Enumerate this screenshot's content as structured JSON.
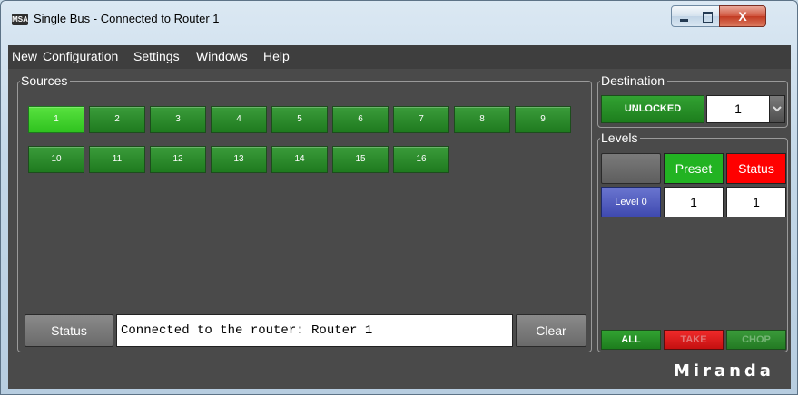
{
  "window": {
    "title": "Single Bus - Connected to Router 1",
    "icon_text": "MSA",
    "close_glyph": "X"
  },
  "menu": [
    "New",
    "Configuration",
    "Settings",
    "Windows",
    "Help"
  ],
  "sources": {
    "title": "Sources",
    "buttons": [
      "1",
      "2",
      "3",
      "4",
      "5",
      "6",
      "7",
      "8",
      "9",
      "10",
      "11",
      "12",
      "13",
      "14",
      "15",
      "16"
    ],
    "selected": "1"
  },
  "status": {
    "button_label": "Status",
    "message": "Connected to the router: Router 1",
    "clear_label": "Clear"
  },
  "destination": {
    "title": "Destination",
    "lock_label": "UNLOCKED",
    "value": "1"
  },
  "levels": {
    "title": "Levels",
    "preset_label": "Preset",
    "status_label": "Status",
    "level_label": "Level 0",
    "preset_value": "1",
    "status_value": "1"
  },
  "actions": {
    "all_label": "ALL",
    "take_label": "TAKE",
    "chop_label": "CHOP"
  },
  "logo_text": "Miranda",
  "colors": {
    "source_active": "#2fc21f",
    "source_normal": "#1f7a1f",
    "preset_green": "#22b322",
    "status_red": "#ff0000",
    "take_red": "#e01515",
    "chop_green": "#2a8f2a",
    "panel_bg": "#4a4a4a"
  }
}
